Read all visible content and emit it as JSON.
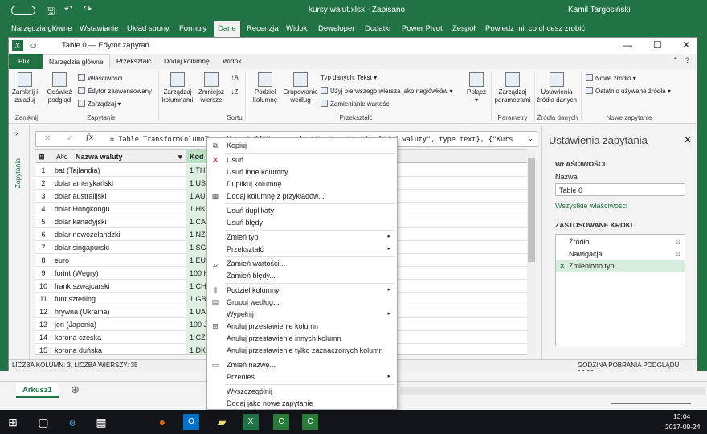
{
  "excel": {
    "doc_title": "kursy walut.xlsx - Zapisano",
    "user": "Kamil Targosiński",
    "tabs": [
      "Narzędzia główne",
      "Wstawianie",
      "Układ strony",
      "Formuły",
      "Dane",
      "Recenzja",
      "Widok",
      "Deweloper",
      "Dodatki",
      "Power Pivot",
      "Zespół"
    ],
    "tell_me": "Powiedz mi, co chcesz zrobić",
    "sheet_tab": "Arkusz1"
  },
  "pq": {
    "window_title": "Table 0 — Edytor zapytań",
    "tabs": {
      "file": "Plik",
      "home": "Narzędzia główne",
      "transform": "Przekształć",
      "add_column": "Dodaj kolumnę",
      "view": "Widok"
    },
    "ribbon": {
      "close_load": "Zamknij i\nzaładuj",
      "refresh": "Odśwież\npodgląd",
      "properties": "Właściwości",
      "advanced_editor": "Edytor zaawansowany",
      "manage": "Zarządzaj",
      "manage_columns": "Zarządzaj\nkolumnami",
      "reduce_rows": "Zmniejsz\nwiersze",
      "split_column": "Podziel\nkolumnę",
      "group_by": "Grupowanie\nwedług",
      "data_type": "Typ danych: Tekst",
      "first_row": "Użyj pierwszego wiersza jako nagłówków",
      "replace_values": "Zamienianie wartości",
      "combine": "Połącz",
      "manage_params": "Zarządzaj\nparametrami",
      "source_settings": "Ustawienia\nźródła danych",
      "new_source": "Nowe źródło",
      "recent_sources": "Ostatnio używane źródła",
      "group_labels": [
        "Zamknij",
        "Zapytanie",
        "Sortuj",
        "Przekształć",
        "Parametry",
        "Źródła danych",
        "Nowe zapytanie"
      ]
    },
    "nav_label": "Zapytania",
    "formula": "= Table.TransformColumnTypes(Dane0,{{\"Nazwa waluty\", type text}, {\"Kod waluty\", type text}, {\"Kurs",
    "columns": [
      "Nazwa waluty",
      "Kod"
    ],
    "rows": [
      [
        "1",
        "bat (Tajlandia)",
        "1 THB"
      ],
      [
        "2",
        "dolar amerykański",
        "1 USD"
      ],
      [
        "3",
        "dolar australijski",
        "1 AUD"
      ],
      [
        "4",
        "dolar Hongkongu",
        "1 HKD"
      ],
      [
        "5",
        "dolar kanadyjski",
        "1 CAD"
      ],
      [
        "6",
        "dolar nowozelandzki",
        "1 NZD"
      ],
      [
        "7",
        "dolar singapurski",
        "1 SGD"
      ],
      [
        "8",
        "euro",
        "1 EUR"
      ],
      [
        "9",
        "forint (Węgry)",
        "100 HUF"
      ],
      [
        "10",
        "frank szwajcarski",
        "1 CHF"
      ],
      [
        "11",
        "funt szterling",
        "1 GBP"
      ],
      [
        "12",
        "hrywna (Ukraina)",
        "1 UAH"
      ],
      [
        "13",
        "jen (Japonia)",
        "100 JPY"
      ],
      [
        "14",
        "korona czeska",
        "1 CZK"
      ],
      [
        "15",
        "korona duńska",
        "1 DKK"
      ]
    ],
    "settings": {
      "title": "Ustawienia zapytania",
      "properties": "WŁAŚCIWOŚCI",
      "name_label": "Nazwa",
      "name_value": "Table 0",
      "all_properties": "Wszystkie właściwości",
      "applied_steps": "ZASTOSOWANE KROKI",
      "steps": [
        "Źródło",
        "Nawigacja",
        "Zmieniono typ"
      ]
    },
    "status_left": "LICZBA KOLUMN: 3, LICZBA WIERSZY: 35",
    "status_right": "GODZINA POBRANIA PODGLĄDU: 13:03"
  },
  "context_menu": {
    "copy": "Kopiuj",
    "remove": "Usuń",
    "remove_other": "Usuń inne kolumny",
    "duplicate": "Duplikuj kolumnę",
    "add_from_examples": "Dodaj kolumnę z przykładów...",
    "remove_duplicates": "Usuń duplikaty",
    "remove_errors": "Usuń błędy",
    "change_type": "Zmień typ",
    "transform": "Przekształć",
    "replace_values": "Zamień wartości...",
    "replace_errors": "Zamień błędy...",
    "split_column": "Podziel kolumny",
    "group_by": "Grupuj według...",
    "fill": "Wypełnij",
    "unpivot": "Anuluj przestawienie kolumn",
    "unpivot_other": "Anuluj przestawienie innych kolumn",
    "unpivot_selected": "Anuluj przestawienie tylko zaznaczonych kolumn",
    "rename": "Zmień nazwę...",
    "move": "Przenieś",
    "drill_down": "Wyszczególnij",
    "add_as_query": "Dodaj jako nowe zapytanie"
  },
  "taskbar": {
    "time": "13:04",
    "date": "2017-09-24"
  }
}
